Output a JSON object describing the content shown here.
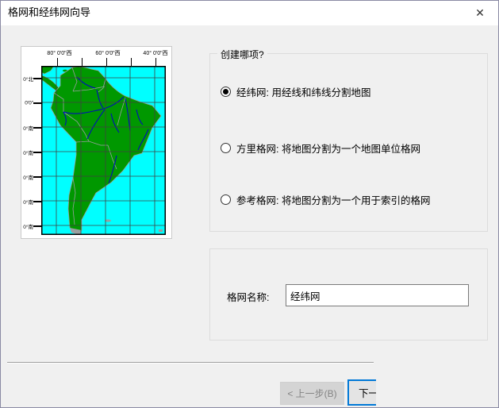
{
  "window": {
    "title": "格网和经纬网向导",
    "close_icon": "✕"
  },
  "map_preview": {
    "top_tick_labels": [
      "80° 0'0\"西",
      "60° 0'0\"西",
      "40° 0'0\"西"
    ],
    "left_tick_labels": [
      "0°北",
      "0'0\"",
      "0°南",
      "0°南",
      "0°南",
      "0°南",
      "0°南"
    ],
    "colors": {
      "ocean": "#00FFFF",
      "land": "#009800",
      "river": "#0000CC",
      "boundary": "#9AA0A0",
      "graticule": "#404040",
      "frame": "#000000"
    }
  },
  "options_group": {
    "title": "创建哪项?",
    "radios": [
      {
        "label": "经纬网: 用经线和纬线分割地图",
        "selected": true
      },
      {
        "label": "方里格网: 将地图分割为一个地图单位格网",
        "selected": false
      },
      {
        "label": "参考格网: 将地图分割为一个用于索引的格网",
        "selected": false
      }
    ]
  },
  "name_section": {
    "label": "格网名称:",
    "value": "经纬网"
  },
  "footer": {
    "back_label": "< 上一步(B)",
    "next_label_visible": "下一",
    "accent_color": "#0078D7"
  }
}
